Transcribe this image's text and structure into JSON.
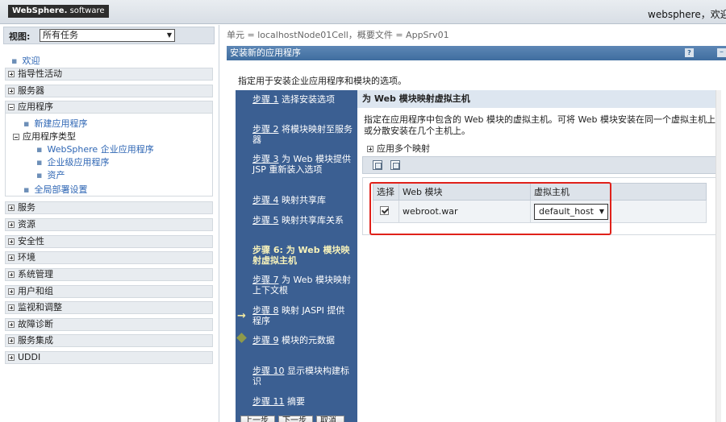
{
  "banner": {
    "logo_brand": "WebSphere.",
    "logo_software": " software",
    "welcome": "websphere，欢迎您"
  },
  "nav": {
    "view_label": "视图:",
    "view_value": "所有任务",
    "welcome": "欢迎",
    "groups": {
      "guided": "指导性活动",
      "servers": "服务器",
      "applications": "应用程序",
      "services": "服务",
      "resources": "资源",
      "security": "安全性",
      "environment": "环境",
      "sysadmin": "系统管理",
      "users": "用户和组",
      "monitoring": "监视和调整",
      "troubleshooting": "故障诊断",
      "integration": "服务集成",
      "uddi": "UDDI"
    },
    "app_children": {
      "new_app": "新建应用程序",
      "app_types": "应用程序类型",
      "websphere_apps": "WebSphere 企业应用程序",
      "enterprise_apps": "企业级应用程序",
      "assets": "资产",
      "global_deploy": "全局部署设置"
    }
  },
  "main": {
    "breadcrumb": "单元 = localhostNode01Cell，概要文件 = AppSrv01",
    "portlet_title": "安装新的应用程序",
    "help_button": "?",
    "minimize_button": "–",
    "description": "指定用于安装企业应用程序和模块的选项。",
    "steps": [
      {
        "link": "步骤 1",
        "text": " 选择安装选项"
      },
      {
        "link": "步骤 2",
        "text": " 将模块映射至服务器"
      },
      {
        "link": "步骤 3",
        "text": " 为 Web 模块提供 JSP 重新装入选项"
      },
      {
        "link": "步骤 4",
        "text": " 映射共享库"
      },
      {
        "link": "步骤 5",
        "text": " 映射共享库关系"
      },
      {
        "link": "步骤 6: 为 Web 模块映射虚拟主机",
        "text": ""
      },
      {
        "link": "步骤 7",
        "text": " 为 Web 模块映射上下文根"
      },
      {
        "link": "步骤 8",
        "text": " 映射 JASPI 提供程序"
      },
      {
        "link": "步骤 9",
        "text": " 模块的元数据"
      },
      {
        "link": "步骤 10",
        "text": " 显示模块构建标识"
      },
      {
        "link": "步骤 11",
        "text": " 摘要"
      }
    ],
    "current_arrow": "→",
    "content_title": "为 Web 模块映射虚拟主机",
    "content_desc": "指定在应用程序中包含的 Web 模块的虚拟主机。可将 Web 模块安装在同一个虚拟主机上或分散安装在几个主机上。",
    "apply_multiple": "应用多个映射",
    "table": {
      "headers": [
        "选择",
        "Web 模块",
        "虚拟主机"
      ],
      "rows": [
        {
          "selected": true,
          "module": "webroot.war",
          "vhost": "default_host"
        }
      ]
    },
    "buttons": {
      "prev": "上一步",
      "next": "下一步",
      "cancel": "取消"
    }
  }
}
